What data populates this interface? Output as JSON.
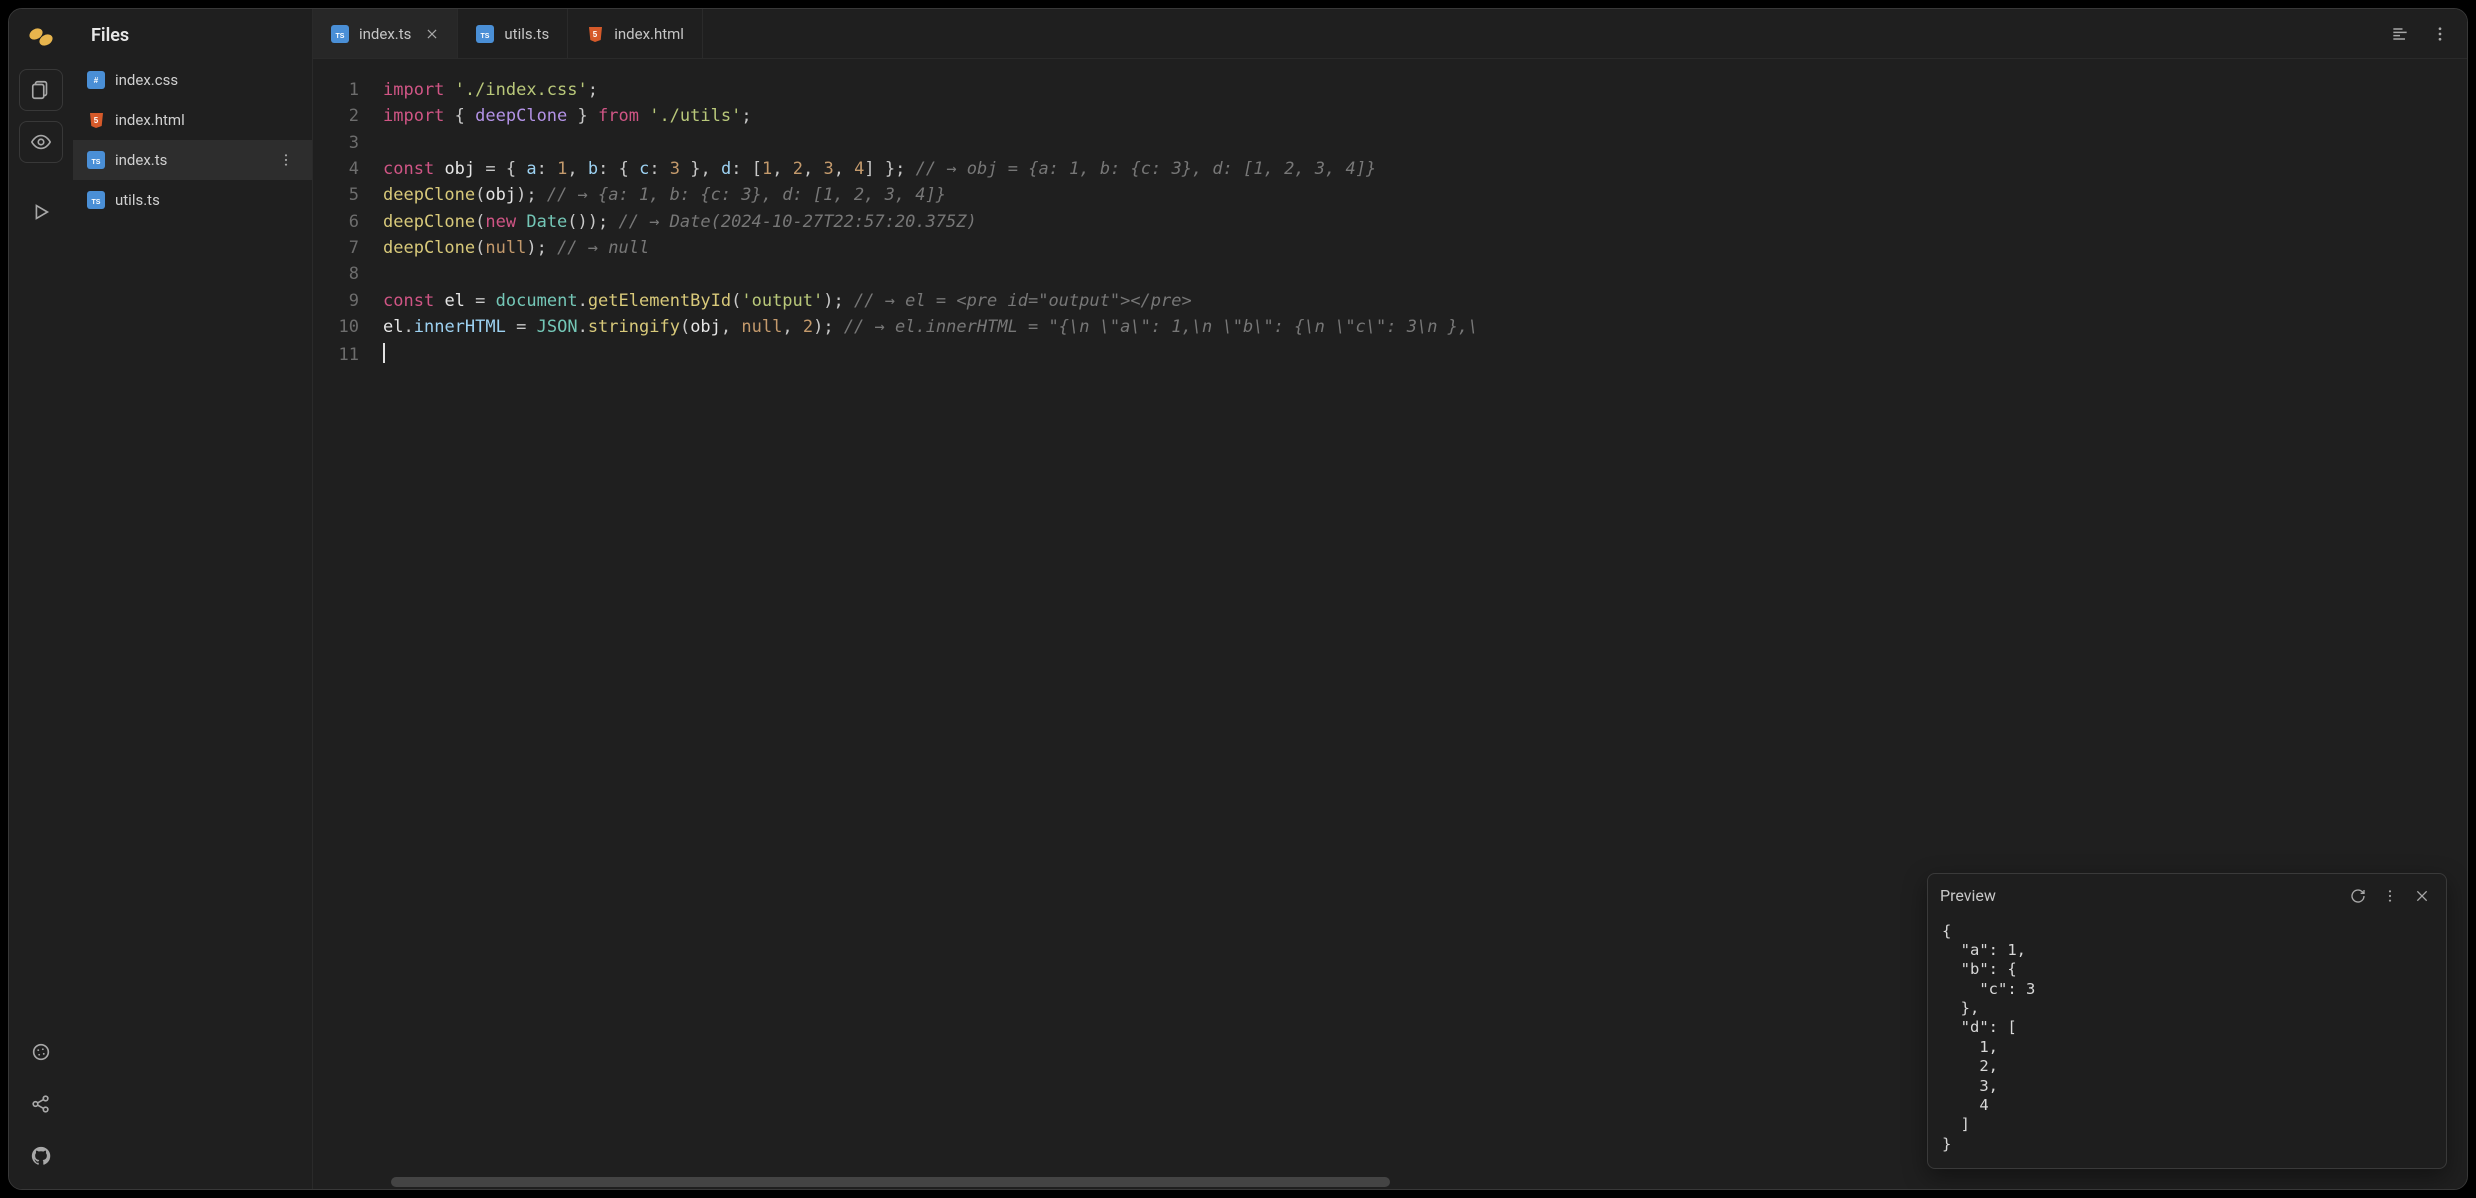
{
  "sidebar": {
    "title": "Files",
    "files": [
      {
        "name": "index.css",
        "type": "css",
        "active": false
      },
      {
        "name": "index.html",
        "type": "html",
        "active": false
      },
      {
        "name": "index.ts",
        "type": "ts",
        "active": true
      },
      {
        "name": "utils.ts",
        "type": "ts",
        "active": false
      }
    ]
  },
  "tabs": [
    {
      "name": "index.ts",
      "type": "ts",
      "active": true,
      "closeable": true
    },
    {
      "name": "utils.ts",
      "type": "ts",
      "active": false,
      "closeable": false
    },
    {
      "name": "index.html",
      "type": "html",
      "active": false,
      "closeable": false
    }
  ],
  "code_lines": [
    {
      "n": 1,
      "segments": [
        [
          "tok-kw",
          "import"
        ],
        [
          "tok-white",
          " "
        ],
        [
          "tok-str",
          "'./index.css'"
        ],
        [
          "tok-punc",
          ";"
        ]
      ]
    },
    {
      "n": 2,
      "segments": [
        [
          "tok-kw",
          "import"
        ],
        [
          "tok-white",
          " "
        ],
        [
          "tok-punc",
          "{ "
        ],
        [
          "tok-ident",
          "deepClone"
        ],
        [
          "tok-punc",
          " } "
        ],
        [
          "tok-kw",
          "from"
        ],
        [
          "tok-white",
          " "
        ],
        [
          "tok-str",
          "'./utils'"
        ],
        [
          "tok-punc",
          ";"
        ]
      ]
    },
    {
      "n": 3,
      "segments": []
    },
    {
      "n": 4,
      "segments": [
        [
          "tok-kw",
          "const"
        ],
        [
          "tok-white",
          " "
        ],
        [
          "tok-var",
          "obj"
        ],
        [
          "tok-white",
          " "
        ],
        [
          "tok-punc",
          "="
        ],
        [
          "tok-white",
          " "
        ],
        [
          "tok-punc",
          "{ "
        ],
        [
          "tok-prop",
          "a"
        ],
        [
          "tok-punc",
          ": "
        ],
        [
          "tok-num",
          "1"
        ],
        [
          "tok-punc",
          ", "
        ],
        [
          "tok-prop",
          "b"
        ],
        [
          "tok-punc",
          ": { "
        ],
        [
          "tok-prop",
          "c"
        ],
        [
          "tok-punc",
          ": "
        ],
        [
          "tok-num",
          "3"
        ],
        [
          "tok-punc",
          " }, "
        ],
        [
          "tok-prop",
          "d"
        ],
        [
          "tok-punc",
          ": ["
        ],
        [
          "tok-num",
          "1"
        ],
        [
          "tok-punc",
          ", "
        ],
        [
          "tok-num",
          "2"
        ],
        [
          "tok-punc",
          ", "
        ],
        [
          "tok-num",
          "3"
        ],
        [
          "tok-punc",
          ", "
        ],
        [
          "tok-num",
          "4"
        ],
        [
          "tok-punc",
          "] };"
        ],
        [
          "tok-white",
          "   "
        ],
        [
          "tok-comment",
          "// → obj = {a: 1, b: {c: 3}, d: [1, 2, 3, 4]}"
        ]
      ]
    },
    {
      "n": 5,
      "segments": [
        [
          "tok-call",
          "deepClone"
        ],
        [
          "tok-punc",
          "("
        ],
        [
          "tok-var",
          "obj"
        ],
        [
          "tok-punc",
          ");"
        ],
        [
          "tok-white",
          "   "
        ],
        [
          "tok-comment",
          "// → {a: 1, b: {c: 3}, d: [1, 2, 3, 4]}"
        ]
      ]
    },
    {
      "n": 6,
      "segments": [
        [
          "tok-call",
          "deepClone"
        ],
        [
          "tok-punc",
          "("
        ],
        [
          "tok-kw",
          "new"
        ],
        [
          "tok-white",
          " "
        ],
        [
          "tok-type",
          "Date"
        ],
        [
          "tok-punc",
          "());"
        ],
        [
          "tok-white",
          "   "
        ],
        [
          "tok-comment",
          "// → Date(2024-10-27T22:57:20.375Z)"
        ]
      ]
    },
    {
      "n": 7,
      "segments": [
        [
          "tok-call",
          "deepClone"
        ],
        [
          "tok-punc",
          "("
        ],
        [
          "tok-null",
          "null"
        ],
        [
          "tok-punc",
          ");"
        ],
        [
          "tok-white",
          "   "
        ],
        [
          "tok-comment",
          "// → null"
        ]
      ]
    },
    {
      "n": 8,
      "segments": []
    },
    {
      "n": 9,
      "segments": [
        [
          "tok-kw",
          "const"
        ],
        [
          "tok-white",
          " "
        ],
        [
          "tok-var",
          "el"
        ],
        [
          "tok-white",
          " "
        ],
        [
          "tok-punc",
          "="
        ],
        [
          "tok-white",
          " "
        ],
        [
          "tok-type",
          "document"
        ],
        [
          "tok-punc",
          "."
        ],
        [
          "tok-call",
          "getElementById"
        ],
        [
          "tok-punc",
          "("
        ],
        [
          "tok-str",
          "'output'"
        ],
        [
          "tok-punc",
          ");"
        ],
        [
          "tok-white",
          "   "
        ],
        [
          "tok-comment",
          "// → el = <pre id=\"output\"></pre>"
        ]
      ]
    },
    {
      "n": 10,
      "segments": [
        [
          "tok-var",
          "el"
        ],
        [
          "tok-punc",
          "."
        ],
        [
          "tok-prop",
          "innerHTML"
        ],
        [
          "tok-white",
          " "
        ],
        [
          "tok-punc",
          "="
        ],
        [
          "tok-white",
          " "
        ],
        [
          "tok-type",
          "JSON"
        ],
        [
          "tok-punc",
          "."
        ],
        [
          "tok-call",
          "stringify"
        ],
        [
          "tok-punc",
          "("
        ],
        [
          "tok-var",
          "obj"
        ],
        [
          "tok-punc",
          ", "
        ],
        [
          "tok-null",
          "null"
        ],
        [
          "tok-punc",
          ", "
        ],
        [
          "tok-num",
          "2"
        ],
        [
          "tok-punc",
          ");"
        ],
        [
          "tok-white",
          "   "
        ],
        [
          "tok-comment",
          "// → el.innerHTML = \"{\\n \\\"a\\\": 1,\\n \\\"b\\\": {\\n \\\"c\\\": 3\\n },\\"
        ]
      ]
    },
    {
      "n": 11,
      "segments": [],
      "cursor": true
    }
  ],
  "preview": {
    "title": "Preview",
    "content": "{\n  \"a\": 1,\n  \"b\": {\n    \"c\": 3\n  },\n  \"d\": [\n    1,\n    2,\n    3,\n    4\n  ]\n}"
  }
}
